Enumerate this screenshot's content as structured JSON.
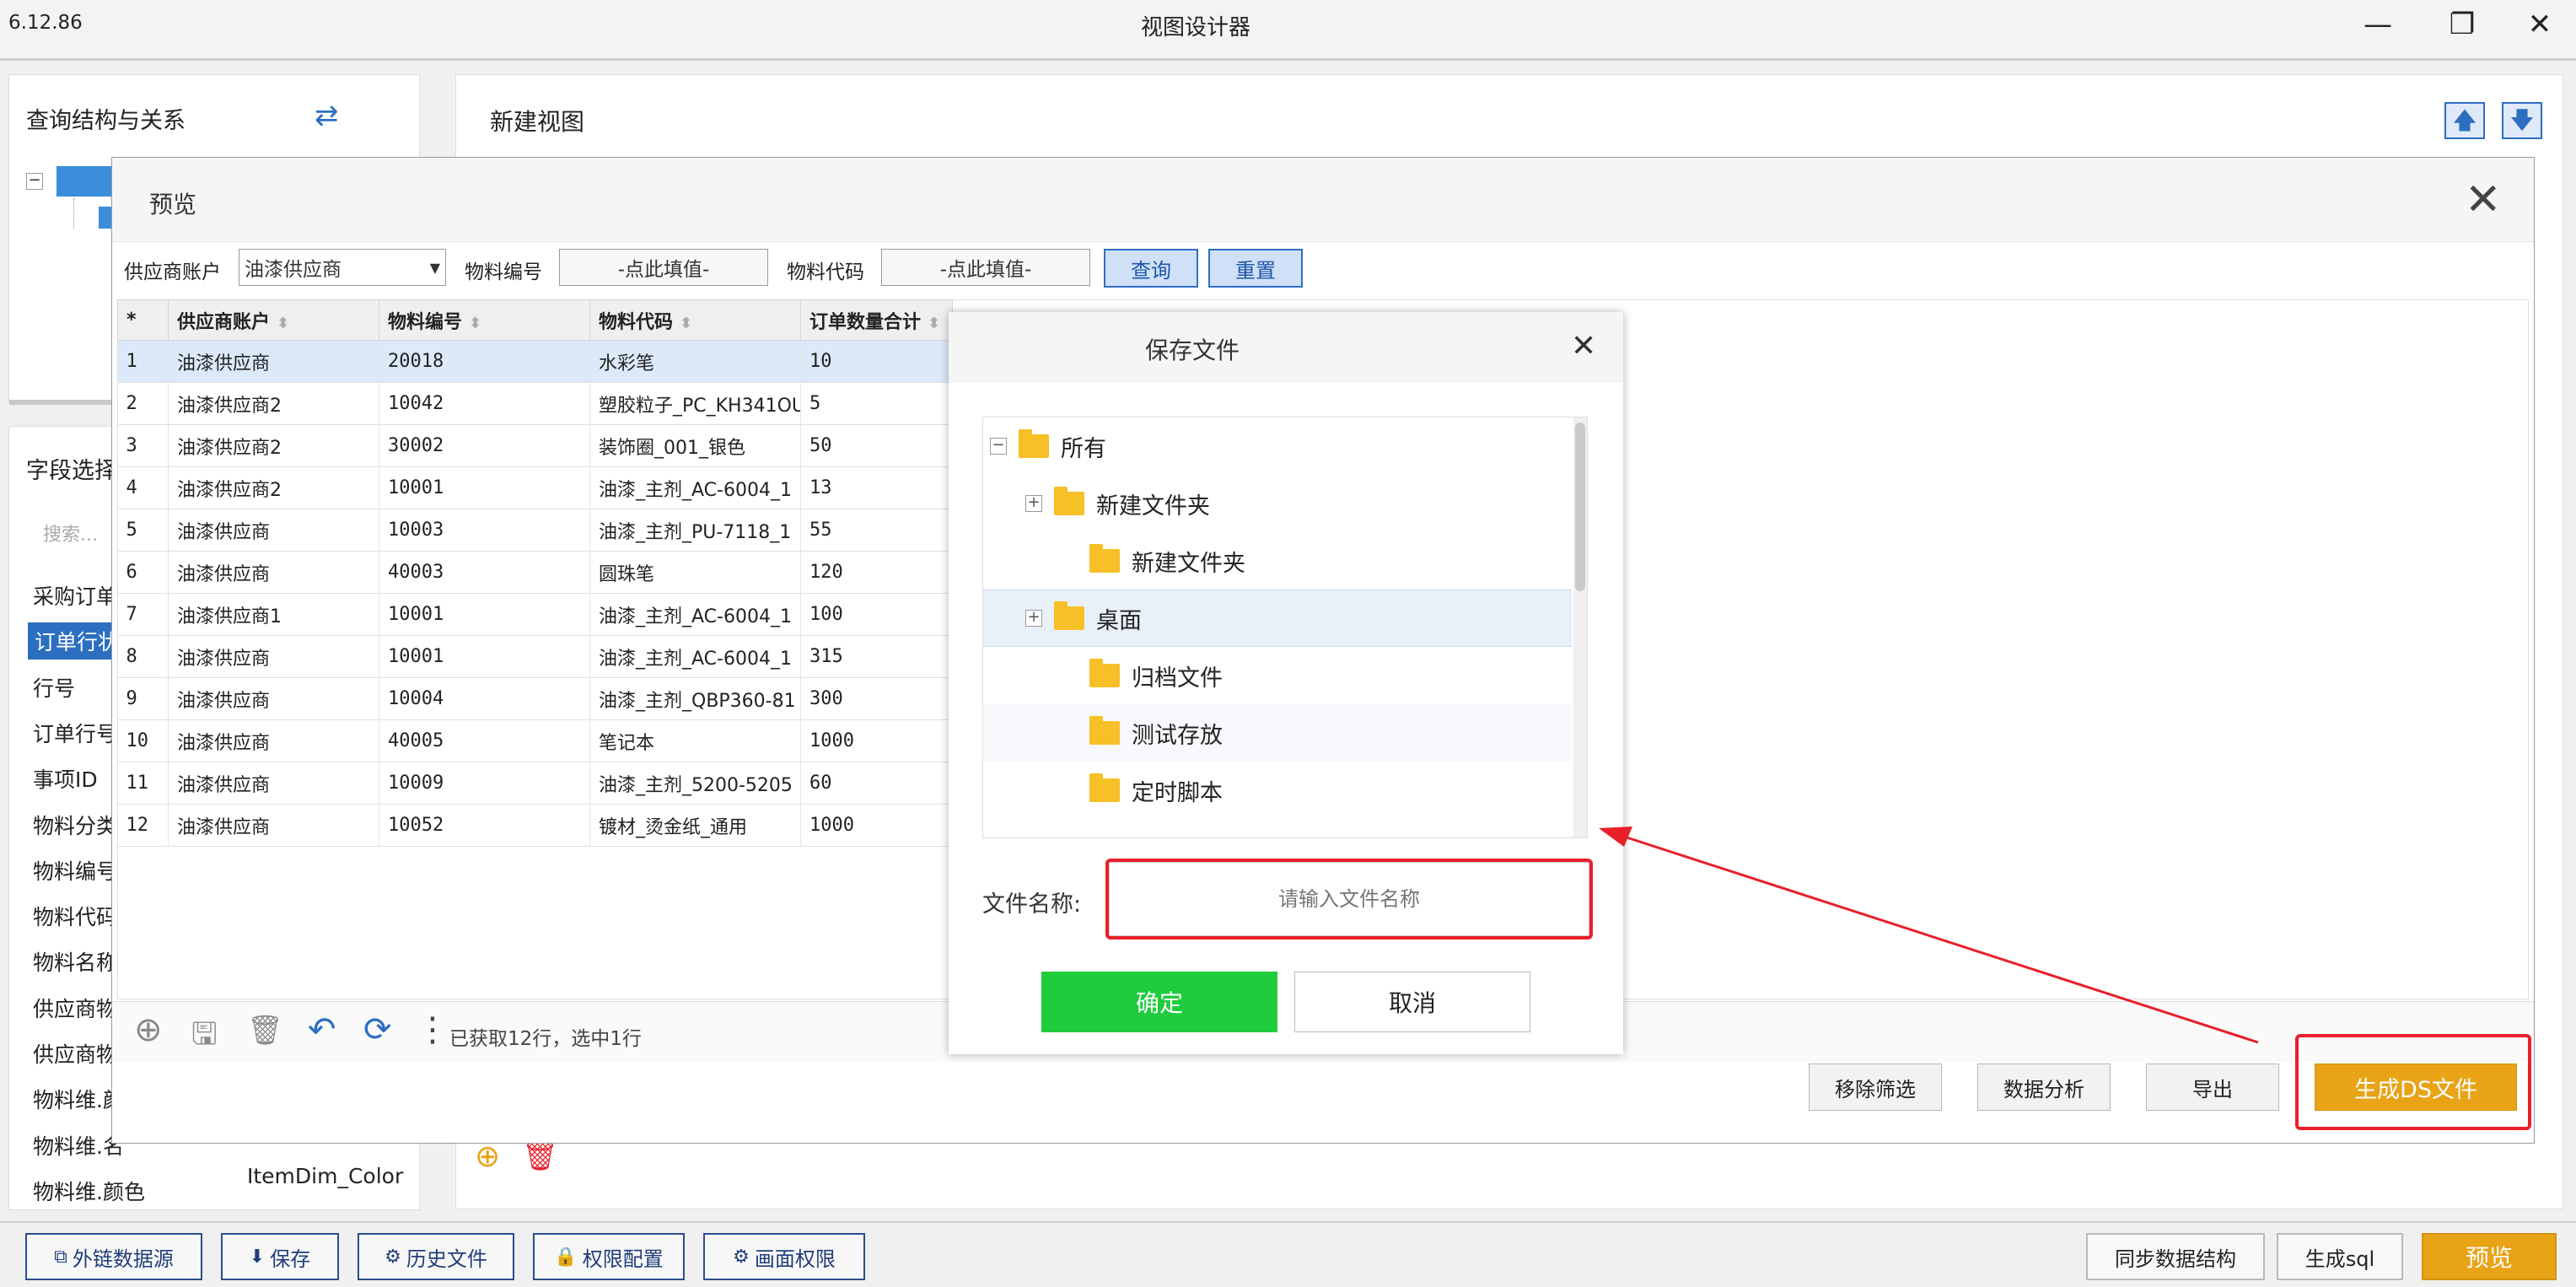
{
  "app": {
    "version": "6.12.86",
    "title": "视图设计器"
  },
  "window_controls": {
    "minimize": "—",
    "restore": "❐",
    "close": "✕"
  },
  "left_panel": {
    "query_title": "查询结构与关系",
    "field_title": "字段选择",
    "search_placeholder": "搜索...",
    "fields": [
      "采购订单",
      "订单行状",
      "行号",
      "订单行号",
      "事项ID",
      "物料分类",
      "物料编号",
      "物料代码",
      "物料名称",
      "供应商物",
      "供应商物",
      "物料维.颜",
      "物料维.名",
      "物料维.颜色"
    ],
    "last_field_value": "ItemDim_Color"
  },
  "main_panel": {
    "title": "新建视图"
  },
  "preview": {
    "title": "预览",
    "filters": {
      "supplier_label": "供应商账户",
      "supplier_value": "油漆供应商",
      "material_no_label": "物料编号",
      "material_no_placeholder": "-点此填值-",
      "material_code_label": "物料代码",
      "material_code_placeholder": "-点此填值-",
      "query_button": "查询",
      "reset_button": "重置"
    },
    "columns": [
      "*",
      "供应商账户",
      "物料编号",
      "物料代码",
      "订单数量合计"
    ],
    "rows": [
      [
        "1",
        "油漆供应商",
        "20018",
        "水彩笔",
        "10"
      ],
      [
        "2",
        "油漆供应商2",
        "10042",
        "塑胶粒子_PC_KH341OU",
        "5"
      ],
      [
        "3",
        "油漆供应商2",
        "30002",
        "装饰圈_001_银色",
        "50"
      ],
      [
        "4",
        "油漆供应商2",
        "10001",
        "油漆_主剂_AC-6004_1",
        "13"
      ],
      [
        "5",
        "油漆供应商",
        "10003",
        "油漆_主剂_PU-7118_1",
        "55"
      ],
      [
        "6",
        "油漆供应商",
        "40003",
        "圆珠笔",
        "120"
      ],
      [
        "7",
        "油漆供应商1",
        "10001",
        "油漆_主剂_AC-6004_1",
        "100"
      ],
      [
        "8",
        "油漆供应商",
        "10001",
        "油漆_主剂_AC-6004_1",
        "315"
      ],
      [
        "9",
        "油漆供应商",
        "10004",
        "油漆_主剂_QBP360-81",
        "300"
      ],
      [
        "10",
        "油漆供应商",
        "40005",
        "笔记本",
        "1000"
      ],
      [
        "11",
        "油漆供应商",
        "10009",
        "油漆_主剂_5200-5205",
        "60"
      ],
      [
        "12",
        "油漆供应商",
        "10052",
        "镀材_烫金纸_通用",
        "1000"
      ]
    ],
    "selected_row": 0,
    "status": "已获取12行，选中1行",
    "actions": {
      "remove_filter": "移除筛选",
      "data_analysis": "数据分析",
      "export": "导出",
      "generate_ds": "生成DS文件"
    }
  },
  "save_dialog": {
    "title": "保存文件",
    "tree": [
      {
        "label": "所有",
        "level": 0,
        "expander": "−"
      },
      {
        "label": "新建文件夹",
        "level": 1,
        "expander": "+"
      },
      {
        "label": "新建文件夹",
        "level": 2,
        "expander": ""
      },
      {
        "label": "桌面",
        "level": 1,
        "expander": "+"
      },
      {
        "label": "归档文件",
        "level": 2,
        "expander": ""
      },
      {
        "label": "测试存放",
        "level": 2,
        "expander": ""
      },
      {
        "label": "定时脚本",
        "level": 2,
        "expander": ""
      }
    ],
    "filename_label": "文件名称:",
    "filename_placeholder": "请输入文件名称",
    "confirm": "确定",
    "cancel": "取消"
  },
  "bottom_bar": {
    "external_source": "外链数据源",
    "save": "保存",
    "history": "历史文件",
    "permission_config": "权限配置",
    "screen_permission": "画面权限",
    "sync_structure": "同步数据结构",
    "generate_sql": "生成sql",
    "preview": "预览"
  },
  "colors": {
    "accent": "#e8a317",
    "confirm_green": "#1fcc3c",
    "highlight_red": "#e8202a",
    "nav_blue": "#2c6fc0"
  }
}
